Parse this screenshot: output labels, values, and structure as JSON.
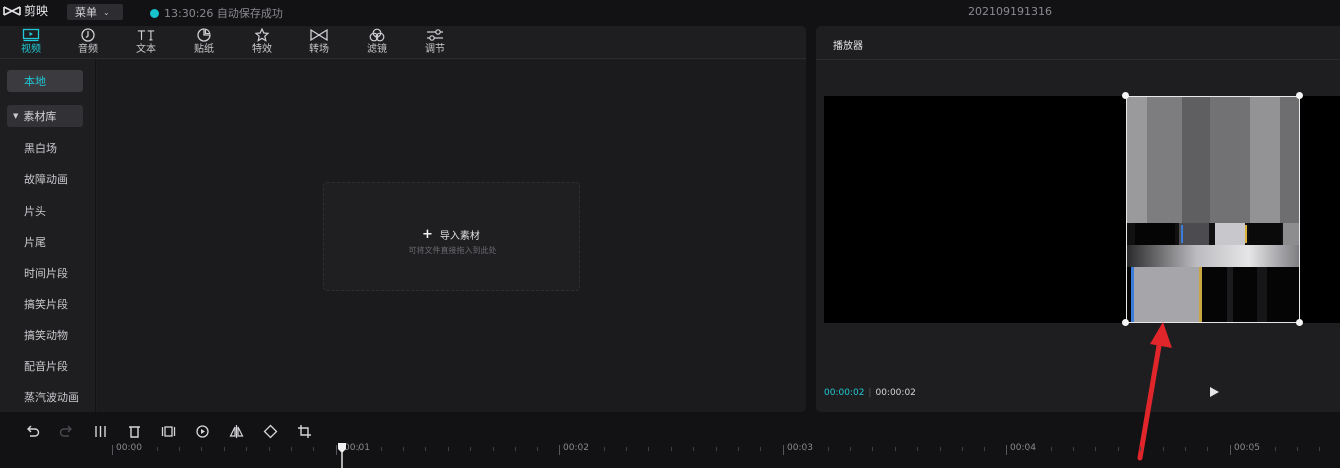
{
  "app": {
    "name": "剪映",
    "menu_label": "菜单",
    "save_status": "13:30:26 自动保存成功",
    "project_name": "202109191316"
  },
  "media_tabs": [
    {
      "label": "视频",
      "icon": "video-icon",
      "active": true
    },
    {
      "label": "音频",
      "icon": "audio-icon",
      "active": false
    },
    {
      "label": "文本",
      "icon": "text-icon",
      "active": false
    },
    {
      "label": "贴纸",
      "icon": "sticker-icon",
      "active": false
    },
    {
      "label": "特效",
      "icon": "effects-icon",
      "active": false
    },
    {
      "label": "转场",
      "icon": "transition-icon",
      "active": false
    },
    {
      "label": "滤镜",
      "icon": "filter-icon",
      "active": false
    },
    {
      "label": "调节",
      "icon": "adjust-icon",
      "active": false
    }
  ],
  "sidebar": {
    "local": "本地",
    "library": "素材库",
    "items": [
      "黑白场",
      "故障动画",
      "片头",
      "片尾",
      "时间片段",
      "搞笑片段",
      "搞笑动物",
      "配音片段",
      "蒸汽波动画"
    ]
  },
  "import": {
    "label": "导入素材",
    "hint": "可将文件直接拖入到此处"
  },
  "player": {
    "title": "播放器",
    "current_time": "00:00:02",
    "total_time": "00:00:02"
  },
  "timeline": {
    "tools": [
      "undo-icon",
      "redo-icon",
      "split-icon",
      "delete-icon",
      "freeze-icon",
      "reverse-icon",
      "mirror-icon",
      "rotate-icon",
      "crop-icon"
    ],
    "ruler_labels": [
      "00:00",
      "00:01",
      "00:02",
      "00:03",
      "00:04",
      "00:05"
    ],
    "playhead_time": "00:01"
  },
  "colors": {
    "accent": "#22c8d5",
    "panel_bg": "#1e1e20",
    "app_bg": "#121214",
    "annotation_arrow": "#e0262b"
  }
}
